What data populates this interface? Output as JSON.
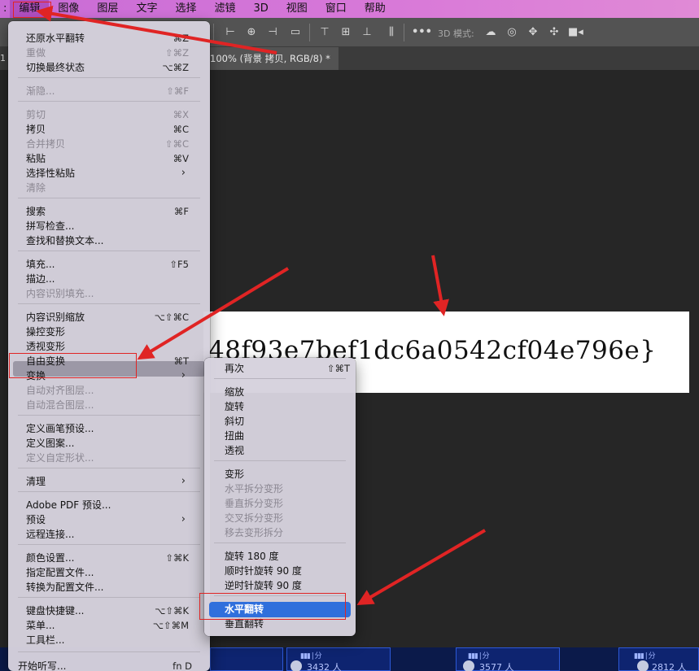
{
  "menubar": {
    "apple_stub": ":",
    "items": [
      "编辑",
      "图像",
      "图层",
      "文字",
      "选择",
      "滤镜",
      "3D",
      "视图",
      "窗口",
      "帮助"
    ]
  },
  "optionsbar": {
    "mode_label": "3D 模式:",
    "align_icons": [
      "align-left-edges-icon",
      "align-horizontal-centers-icon",
      "align-right-edges-icon",
      "distribute-icon",
      "align-top-edges-icon",
      "align-vertical-centers-icon",
      "align-bottom-edges-icon",
      "distribute-vertical-icon",
      "more-icon"
    ],
    "mode_icons": [
      "orbit-3d-icon",
      "roll-3d-icon",
      "pan-3d-icon",
      "slide-3d-icon",
      "scale-3d-icon"
    ]
  },
  "document": {
    "tab_stub": "1",
    "tab_title": "100% (背景 拷贝, RGB/8) *"
  },
  "canvas": {
    "image_text": "48f93e7bef1dc6a0542cf04e796e}"
  },
  "bottom_strip": {
    "bat_glyph": "▮▮▮ | 分",
    "counts": [
      "3432 人",
      "3577 人",
      "2812 人"
    ]
  },
  "edit_menu": {
    "items": [
      {
        "label": "还原水平翻转",
        "shortcut": "⌘Z",
        "disabled": false
      },
      {
        "label": "重做",
        "shortcut": "⇧⌘Z",
        "disabled": true
      },
      {
        "label": "切换最终状态",
        "shortcut": "⌥⌘Z",
        "disabled": false
      },
      {
        "label": "渐隐...",
        "shortcut": "⇧⌘F",
        "disabled": true
      },
      {
        "label": "剪切",
        "shortcut": "⌘X",
        "disabled": true
      },
      {
        "label": "拷贝",
        "shortcut": "⌘C",
        "disabled": false
      },
      {
        "label": "合并拷贝",
        "shortcut": "⇧⌘C",
        "disabled": true
      },
      {
        "label": "粘贴",
        "shortcut": "⌘V",
        "disabled": false
      },
      {
        "label": "选择性粘贴",
        "shortcut": "",
        "disabled": false,
        "submenu": true
      },
      {
        "label": "清除",
        "shortcut": "",
        "disabled": true
      },
      {
        "label": "搜索",
        "shortcut": "⌘F",
        "disabled": false
      },
      {
        "label": "拼写检查...",
        "shortcut": "",
        "disabled": false
      },
      {
        "label": "查找和替换文本...",
        "shortcut": "",
        "disabled": false
      },
      {
        "label": "填充...",
        "shortcut": "⇧F5",
        "disabled": false
      },
      {
        "label": "描边...",
        "shortcut": "",
        "disabled": false
      },
      {
        "label": "内容识别填充...",
        "shortcut": "",
        "disabled": true
      },
      {
        "label": "内容识别缩放",
        "shortcut": "⌥⇧⌘C",
        "disabled": false
      },
      {
        "label": "操控变形",
        "shortcut": "",
        "disabled": false
      },
      {
        "label": "透视变形",
        "shortcut": "",
        "disabled": false
      },
      {
        "label": "自由变换",
        "shortcut": "⌘T",
        "disabled": false
      },
      {
        "label": "变换",
        "shortcut": "",
        "disabled": false,
        "submenu": true,
        "highlighted": true
      },
      {
        "label": "自动对齐图层...",
        "shortcut": "",
        "disabled": true
      },
      {
        "label": "自动混合图层...",
        "shortcut": "",
        "disabled": true
      },
      {
        "label": "定义画笔预设...",
        "shortcut": "",
        "disabled": false
      },
      {
        "label": "定义图案...",
        "shortcut": "",
        "disabled": false
      },
      {
        "label": "定义自定形状...",
        "shortcut": "",
        "disabled": true
      },
      {
        "label": "清理",
        "shortcut": "",
        "disabled": false,
        "submenu": true
      },
      {
        "label": "Adobe PDF 预设...",
        "shortcut": "",
        "disabled": false
      },
      {
        "label": "预设",
        "shortcut": "",
        "disabled": false,
        "submenu": true
      },
      {
        "label": "远程连接...",
        "shortcut": "",
        "disabled": false
      },
      {
        "label": "颜色设置...",
        "shortcut": "⇧⌘K",
        "disabled": false
      },
      {
        "label": "指定配置文件...",
        "shortcut": "",
        "disabled": false
      },
      {
        "label": "转换为配置文件...",
        "shortcut": "",
        "disabled": false
      },
      {
        "label": "键盘快捷键...",
        "shortcut": "⌥⇧⌘K",
        "disabled": false
      },
      {
        "label": "菜单...",
        "shortcut": "⌥⇧⌘M",
        "disabled": false
      },
      {
        "label": "工具栏...",
        "shortcut": "",
        "disabled": false
      },
      {
        "label": "开始听写...",
        "shortcut": "fn D",
        "disabled": false
      }
    ]
  },
  "transform_menu": {
    "items": [
      {
        "label": "再次",
        "shortcut": "⇧⌘T",
        "disabled": false
      },
      {
        "label": "缩放",
        "shortcut": "",
        "disabled": false
      },
      {
        "label": "旋转",
        "shortcut": "",
        "disabled": false
      },
      {
        "label": "斜切",
        "shortcut": "",
        "disabled": false
      },
      {
        "label": "扭曲",
        "shortcut": "",
        "disabled": false
      },
      {
        "label": "透视",
        "shortcut": "",
        "disabled": false
      },
      {
        "label": "变形",
        "shortcut": "",
        "disabled": false
      },
      {
        "label": "水平拆分变形",
        "shortcut": "",
        "disabled": true
      },
      {
        "label": "垂直拆分变形",
        "shortcut": "",
        "disabled": true
      },
      {
        "label": "交叉拆分变形",
        "shortcut": "",
        "disabled": true
      },
      {
        "label": "移去变形拆分",
        "shortcut": "",
        "disabled": true
      },
      {
        "label": "旋转 180 度",
        "shortcut": "",
        "disabled": false
      },
      {
        "label": "顺时针旋转 90 度",
        "shortcut": "",
        "disabled": false
      },
      {
        "label": "逆时针旋转 90 度",
        "shortcut": "",
        "disabled": false
      },
      {
        "label": "水平翻转",
        "shortcut": "",
        "disabled": false,
        "highlighted": true
      },
      {
        "label": "垂直翻转",
        "shortcut": "",
        "disabled": false
      }
    ]
  },
  "colors": {
    "menubar_bg": "#d97ad8",
    "selection_blue": "#2f6fdc",
    "annotation_red": "#e02424"
  }
}
